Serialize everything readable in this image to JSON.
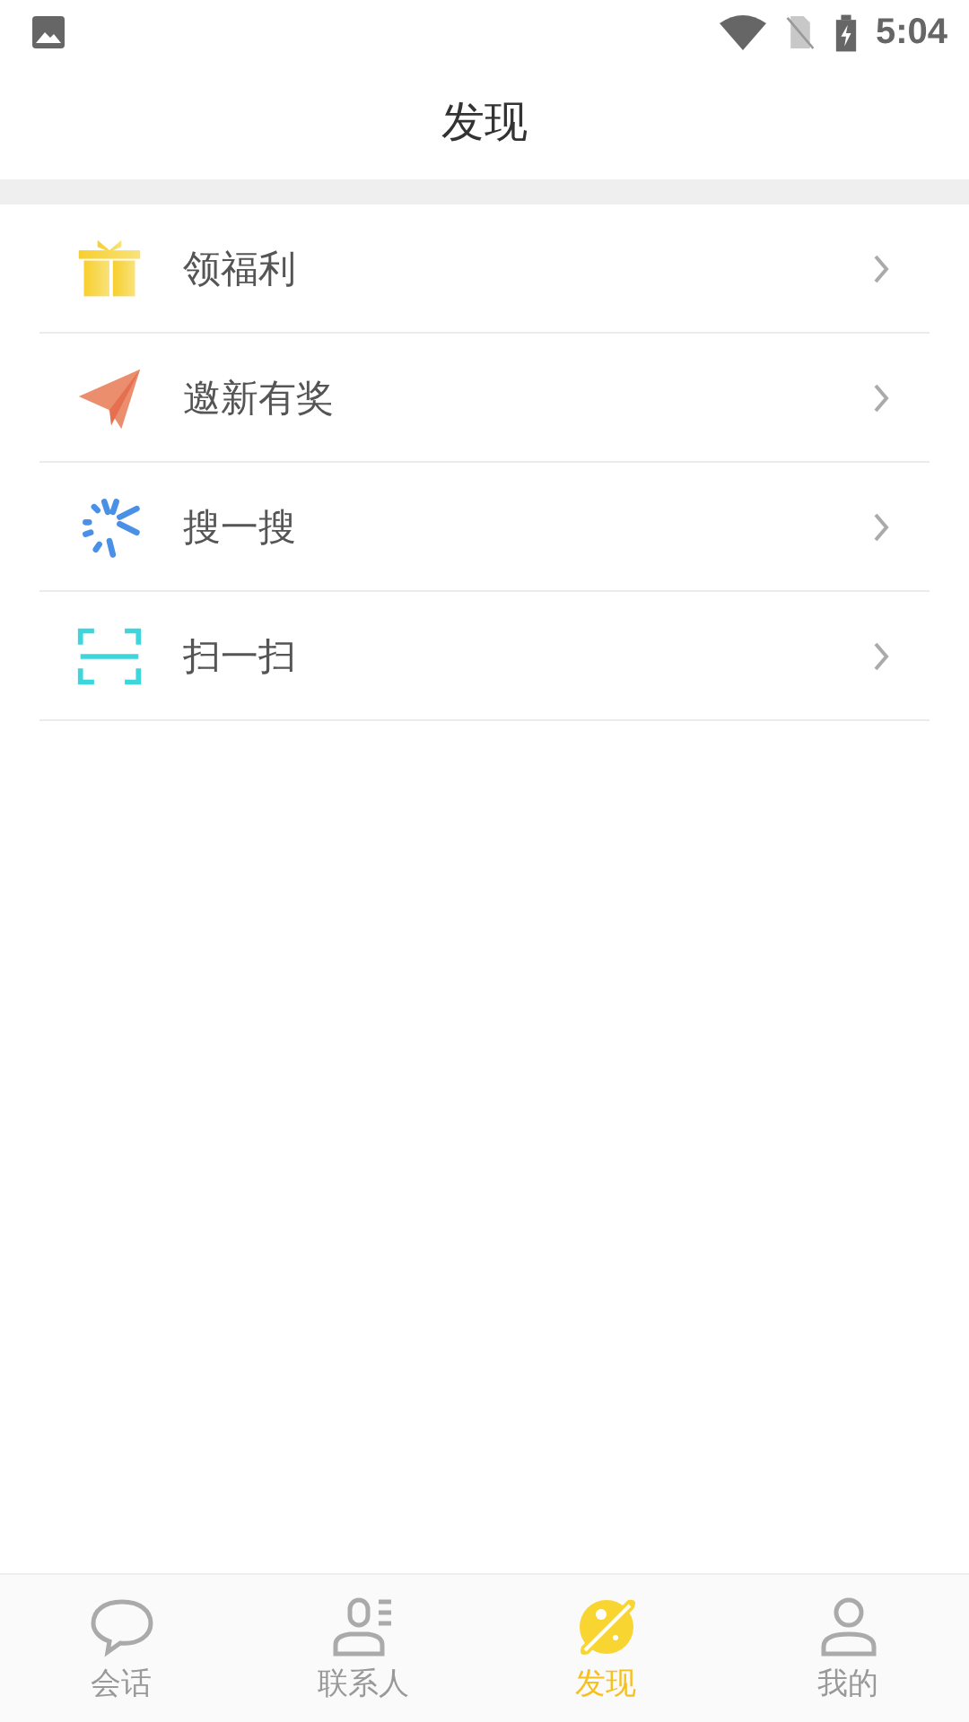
{
  "status_bar": {
    "time": "5:04"
  },
  "header": {
    "title": "发现"
  },
  "items": [
    {
      "kind": "gift",
      "label": "领福利"
    },
    {
      "kind": "plane",
      "label": "邀新有奖"
    },
    {
      "kind": "burst",
      "label": "搜一搜"
    },
    {
      "kind": "scan",
      "label": "扫一扫"
    }
  ],
  "tabs": [
    {
      "kind": "chat",
      "label": "会话",
      "selected": false
    },
    {
      "kind": "contacts",
      "label": "联系人",
      "selected": false
    },
    {
      "kind": "planet",
      "label": "发现",
      "selected": true
    },
    {
      "kind": "person",
      "label": "我的",
      "selected": false
    }
  ]
}
